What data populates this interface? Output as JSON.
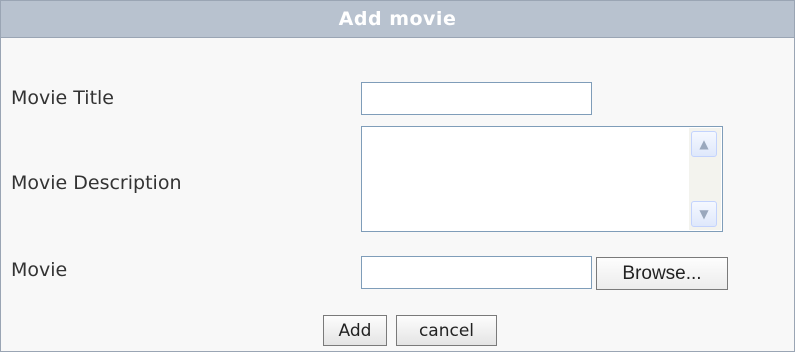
{
  "dialog": {
    "title": "Add movie"
  },
  "form": {
    "movie_title": {
      "label": "Movie Title",
      "value": ""
    },
    "movie_description": {
      "label": "Movie Description",
      "value": ""
    },
    "movie_file": {
      "label": "Movie",
      "value": "",
      "browse_label": "Browse..."
    }
  },
  "actions": {
    "add_label": "Add",
    "cancel_label": "cancel"
  },
  "icons": {
    "scroll_up": "scroll-up-arrow-icon",
    "scroll_down": "scroll-down-arrow-icon"
  },
  "colors": {
    "header_bg": "#b8c2cf",
    "header_text": "#ffffff",
    "panel_bg": "#f8f8f8",
    "input_border": "#7f9db9"
  }
}
